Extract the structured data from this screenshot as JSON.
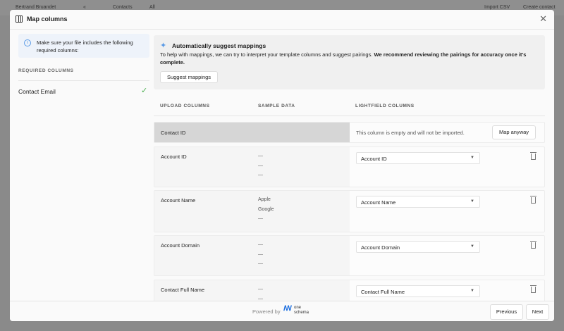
{
  "background": {
    "user": "Bertrand Bruandet",
    "tab_contacts": "Contacts",
    "tab_all": "All",
    "import_csv": "Import CSV",
    "create_contact": "Create contact"
  },
  "modal": {
    "title": "Map columns",
    "info": "Make sure your file includes the following required columns:",
    "required_label": "REQUIRED COLUMNS",
    "required_items": [
      {
        "label": "Contact Email",
        "status": "satisfied"
      }
    ],
    "suggest": {
      "title": "Automatically suggest mappings",
      "description_plain": "To help with mappings, we can try to interpret your template columns and suggest pairings. ",
      "description_bold": "We recommend reviewing the pairings for accuracy once it's complete.",
      "button": "Suggest mappings"
    },
    "columns": {
      "upload": "UPLOAD COLUMNS",
      "sample": "SAMPLE DATA",
      "lightfield": "LIGHTFIELD COLUMNS"
    },
    "rows": [
      {
        "name": "Contact ID",
        "empty_message": "This column is empty and will not be imported.",
        "action": "Map anyway"
      },
      {
        "name": "Account ID",
        "samples": [
          "—",
          "—",
          "—"
        ],
        "mapped": "Account ID"
      },
      {
        "name": "Account Name",
        "samples": [
          "Apple",
          "Google",
          "—"
        ],
        "mapped": "Account Name"
      },
      {
        "name": "Account Domain",
        "samples": [
          "—",
          "—",
          "—"
        ],
        "mapped": "Account Domain"
      },
      {
        "name": "Contact Full Name",
        "samples": [
          "—",
          "—"
        ],
        "mapped": "Contact Full Name"
      }
    ],
    "footer": {
      "powered_by": "Powered by",
      "brand_line1": "one",
      "brand_line2": "schema",
      "previous": "Previous",
      "next": "Next"
    }
  }
}
